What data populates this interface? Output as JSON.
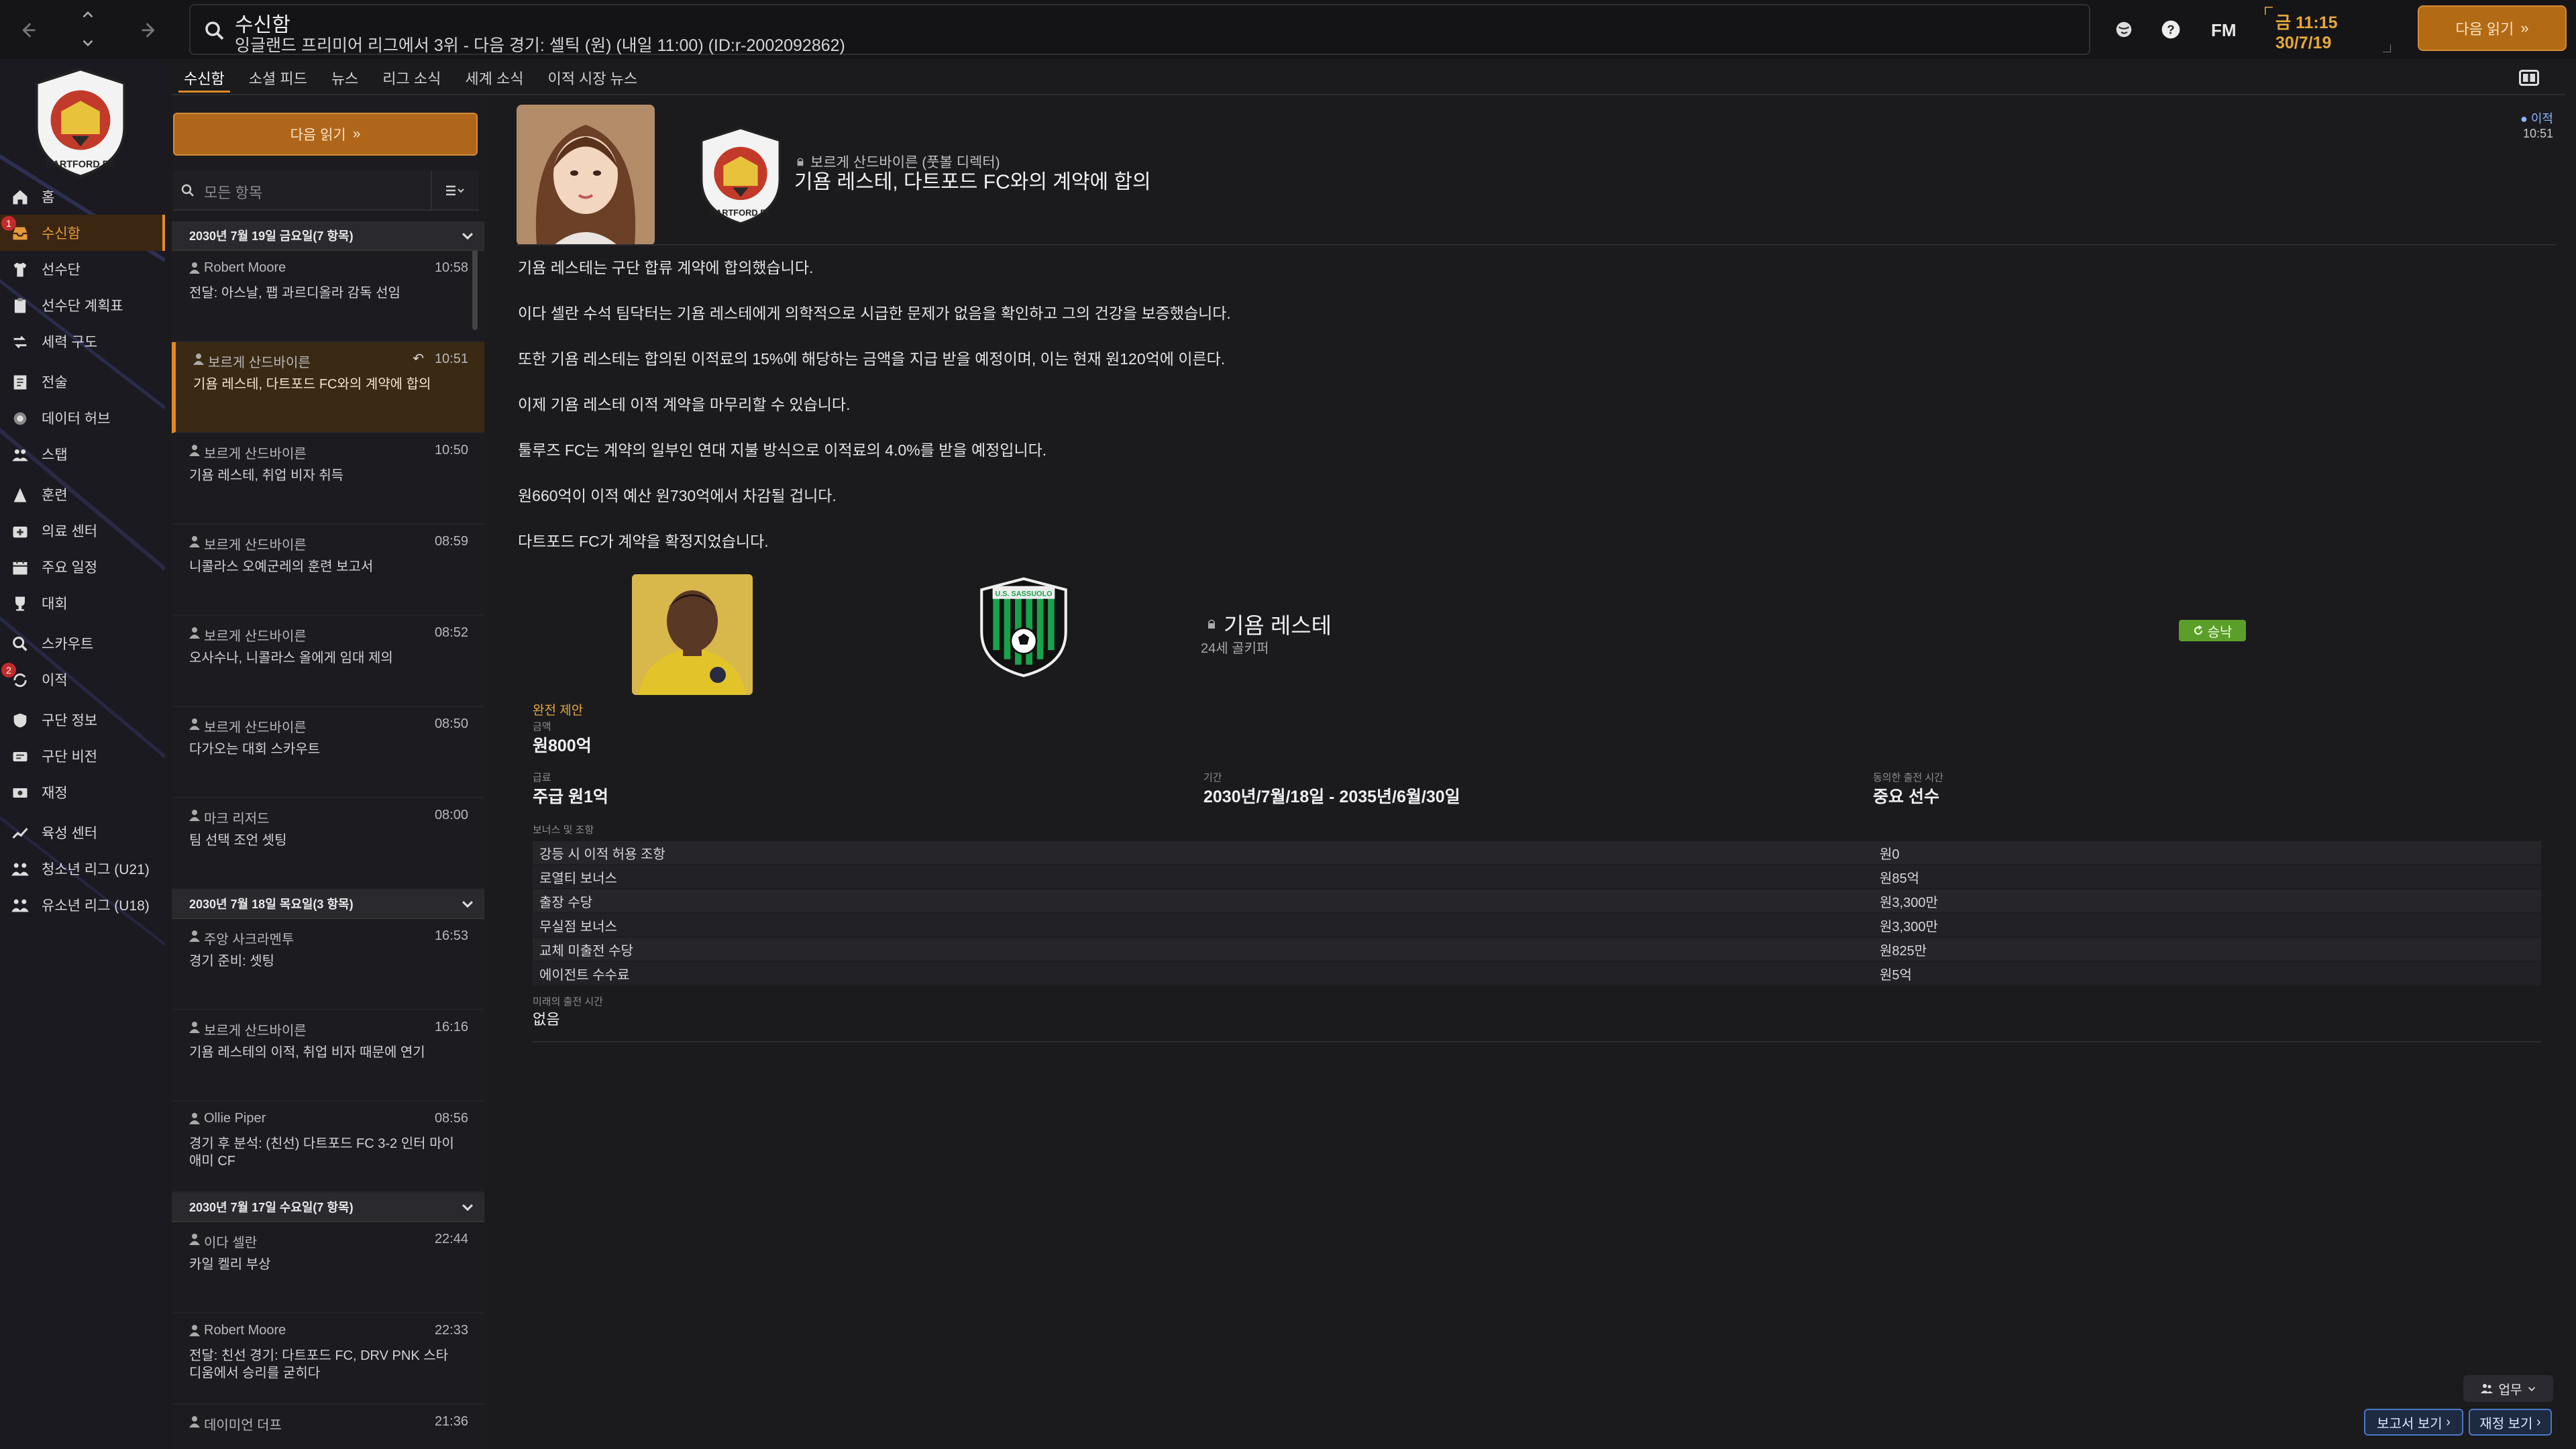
{
  "topbar": {
    "title": "수신함",
    "subtitle": "잉글랜드 프리미어 리그에서 3위 - 다음 경기: 셀틱 (원) (내일 11:00) (ID:r-2002092862)",
    "brand": "FM",
    "clock": "금 11:15",
    "date": "30/7/19",
    "continue_label": "다음 읽기",
    "continue_arrow": "»"
  },
  "sidebar": {
    "items": [
      {
        "label": "홈",
        "icon": "home-icon"
      },
      {
        "label": "수신함",
        "icon": "inbox-icon",
        "active": true,
        "badge": "1"
      },
      {
        "label": "선수단",
        "icon": "shirt-icon"
      },
      {
        "label": "선수단 계획표",
        "icon": "clipboard-icon"
      },
      {
        "label": "세력 구도",
        "icon": "dynamics-icon"
      },
      {
        "label": "전술",
        "icon": "tactics-icon"
      },
      {
        "label": "데이터 허브",
        "icon": "data-icon"
      },
      {
        "label": "스탭",
        "icon": "staff-icon"
      },
      {
        "label": "훈련",
        "icon": "training-icon"
      },
      {
        "label": "의료 센터",
        "icon": "medical-icon"
      },
      {
        "label": "주요 일정",
        "icon": "calendar-icon"
      },
      {
        "label": "대회",
        "icon": "trophy-icon"
      },
      {
        "label": "스카우트",
        "icon": "scout-icon"
      },
      {
        "label": "이적",
        "icon": "transfer-icon",
        "badge": "2"
      },
      {
        "label": "구단 정보",
        "icon": "shield-icon"
      },
      {
        "label": "구단 비전",
        "icon": "vision-icon"
      },
      {
        "label": "재정",
        "icon": "finance-icon"
      },
      {
        "label": "육성 센터",
        "icon": "development-icon"
      },
      {
        "label": "청소년 리그 (U21)",
        "icon": "youth-icon"
      },
      {
        "label": "유소년 리그 (U18)",
        "icon": "youth-icon"
      }
    ]
  },
  "tabs": [
    "수신함",
    "소셜 피드",
    "뉴스",
    "리그 소식",
    "세계 소식",
    "이적 시장 뉴스"
  ],
  "inbox": {
    "continue_label": "다음 읽기",
    "filter_placeholder": "모든 항목",
    "groups": [
      {
        "header": "2030년 7월 19일 금요일(7 항목)",
        "messages": [
          {
            "sender": "Robert Moore",
            "time": "10:58",
            "subject": "전달: 아스날, 팹 과르디올라 감독 선임"
          },
          {
            "sender": "보르게 산드바이른",
            "time": "10:51",
            "subject": "기욤 레스테, 다트포드 FC와의 계약에 합의",
            "selected": true
          },
          {
            "sender": "보르게 산드바이른",
            "time": "10:50",
            "subject": "기욤 레스테, 취업 비자 취득"
          },
          {
            "sender": "보르게 산드바이른",
            "time": "08:59",
            "subject": "니콜라스 오예군레의 훈련 보고서"
          },
          {
            "sender": "보르게 산드바이른",
            "time": "08:52",
            "subject": "오사수나, 니콜라스 올에게 임대 제의"
          },
          {
            "sender": "보르게 산드바이른",
            "time": "08:50",
            "subject": "다가오는 대회 스카우트"
          },
          {
            "sender": "마크 리저드",
            "time": "08:00",
            "subject": "팀 선택 조언 셋팅"
          }
        ]
      },
      {
        "header": "2030년 7월 18일 목요일(3 항목)",
        "messages": [
          {
            "sender": "주앙 사크라멘투",
            "time": "16:53",
            "subject": "경기 준비: 셋팅"
          },
          {
            "sender": "보르게 산드바이른",
            "time": "16:16",
            "subject": "기욤 레스테의 이적, 취업 비자 때문에 연기"
          },
          {
            "sender": "Ollie Piper",
            "time": "08:56",
            "subject": "경기 후 분석: (친선) 다트포드 FC 3-2 인터 마이애미 CF"
          }
        ]
      },
      {
        "header": "2030년 7월 17일 수요일(7 항목)",
        "messages": [
          {
            "sender": "이다 셀란",
            "time": "22:44",
            "subject": "카일 켈리 부상"
          },
          {
            "sender": "Robert Moore",
            "time": "22:33",
            "subject": "전달: 친선 경기: 다트포드 FC, DRV PNK 스타디움에서 승리를 굳히다"
          },
          {
            "sender": "데이미언 더프",
            "time": "21:36",
            "subject": ""
          }
        ]
      }
    ]
  },
  "message": {
    "from": "보르게 산드바이른 (풋볼 디렉터)",
    "headline": "기욤 레스테, 다트포드 FC와의 계약에 합의",
    "tag": "이적",
    "tag_time": "10:51",
    "paragraphs": [
      "기욤 레스테는 구단 합류 계약에 합의했습니다.",
      "이다 셀란 수석 팀닥터는 기욤 레스테에게 의학적으로 시급한 문제가 없음을 확인하고 그의 건강을 보증했습니다.",
      "또한 기욤 레스테는 합의된 이적료의 15%에 해당하는 금액을 지급 받을 예정이며, 이는 현재 원120억에 이른다.",
      "이제 기욤 레스테 이적 계약을 마무리할 수 있습니다.",
      "툴루즈 FC는 계약의 일부인 연대 지불 방식으로 이적료의 4.0%를 받을 예정입니다.",
      "원660억이 이적 예산 원730억에서 차감될 겁니다.",
      "다트포드 FC가 계약을 확정지었습니다."
    ],
    "player": {
      "name": "기욤 레스테",
      "sub": "24세 골키퍼",
      "status": "승낙"
    },
    "offer": {
      "type_label": "완전 제안",
      "fee_label": "금액",
      "fee": "원800억",
      "wage_label": "급료",
      "wage": "주급 원1억",
      "term_label": "기간",
      "term": "2030년/7월/18일 - 2035년/6월/30일",
      "playing_time_label": "동의한 출전 시간",
      "playing_time": "중요 선수",
      "bonus_label": "보너스 및 조항",
      "bonuses": [
        {
          "name": "강등 시 이적 허용 조항",
          "value": "원0"
        },
        {
          "name": "로열티 보너스",
          "value": "원85억"
        },
        {
          "name": "출장 수당",
          "value": "원3,300만"
        },
        {
          "name": "무실점 보너스",
          "value": "원3,300만"
        },
        {
          "name": "교체 미출전 수당",
          "value": "원825만"
        },
        {
          "name": "에이전트 수수료",
          "value": "원5억"
        }
      ],
      "future_time_label": "미래의 출전 시간",
      "future_time": "없음"
    }
  },
  "bottom": {
    "task_label": "업무",
    "report_label": "보고서 보기",
    "finance_label": "재정 보기"
  },
  "colors": {
    "accent": "#e08a24",
    "accepted": "#5c9e2a",
    "link_blue": "#4c78c8"
  }
}
